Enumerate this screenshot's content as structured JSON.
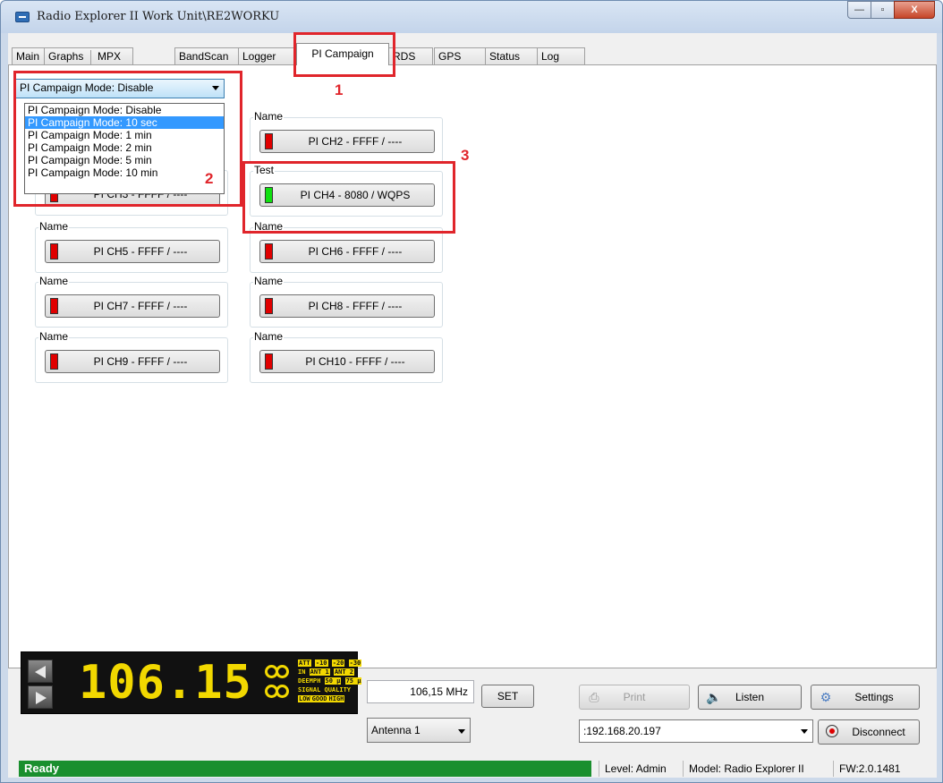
{
  "window": {
    "title": "Radio Explorer II Work Unit\\RE2WORKU",
    "controls": {
      "minimize": "—",
      "maximize": "▫",
      "close": "X"
    }
  },
  "tabs": [
    {
      "label": "Main"
    },
    {
      "label": "Graphs"
    },
    {
      "label": "MPX"
    },
    {
      "label": "BandScan"
    },
    {
      "label": "Logger"
    },
    {
      "label": "PI Campaign"
    },
    {
      "label": "RDS"
    },
    {
      "label": "GPS"
    },
    {
      "label": "Status"
    },
    {
      "label": "Log"
    }
  ],
  "active_tab": "PI Campaign",
  "campaign": {
    "mode_selected": "PI Campaign Mode: Disable",
    "mode_options": [
      "PI Campaign Mode: Disable",
      "PI Campaign Mode: 10 sec",
      "PI Campaign Mode: 1 min",
      "PI Campaign Mode: 2 min",
      "PI Campaign Mode: 5 min",
      "PI Campaign Mode: 10 min"
    ],
    "highlighted_option": "PI Campaign Mode: 10 sec",
    "channels": [
      {
        "group_name": "Name",
        "label": "PI CH2 - FFFF / ----",
        "status": "red"
      },
      {
        "group_name": "",
        "label": "PI CH3 - FFFF / ----",
        "status": "red"
      },
      {
        "group_name": "Test",
        "label": "PI CH4 - 8080 / WQPS",
        "status": "green"
      },
      {
        "group_name": "Name",
        "label": "PI CH5 - FFFF / ----",
        "status": "red"
      },
      {
        "group_name": "Name",
        "label": "PI CH6 - FFFF / ----",
        "status": "red"
      },
      {
        "group_name": "Name",
        "label": "PI CH7 - FFFF / ----",
        "status": "red"
      },
      {
        "group_name": "Name",
        "label": "PI CH8 - FFFF / ----",
        "status": "red"
      },
      {
        "group_name": "Name",
        "label": "PI CH9 - FFFF / ----",
        "status": "red"
      },
      {
        "group_name": "Name",
        "label": "PI CH10 - FFFF / ----",
        "status": "red"
      }
    ]
  },
  "annotations": [
    "1",
    "2",
    "3"
  ],
  "display": {
    "digits": "106.15",
    "indicators": {
      "att": [
        "ATT",
        "-10",
        "-20",
        "-30"
      ],
      "input": [
        "IN",
        "ANT 1",
        "ANT 2"
      ],
      "deemph": [
        "DEEMPH",
        "50 μ",
        "75 μ"
      ],
      "signal_quality": "SIGNAL QUALITY",
      "levels": [
        "LOW",
        "GOOD",
        "HIGH"
      ]
    }
  },
  "controls": {
    "frequency": "106,15 MHz",
    "set_label": "SET",
    "antenna": "Antenna 1",
    "print_label": "Print",
    "listen_label": "Listen",
    "settings_label": "Settings",
    "address": ":192.168.20.197",
    "disconnect_label": "Disconnect"
  },
  "status": {
    "state": "Ready",
    "level": "Level: Admin",
    "model": "Model: Radio Explorer II",
    "fw": "FW:2.0.1481"
  },
  "colors": {
    "led_red": "#e00000",
    "led_green": "#10e010",
    "display_digits": "#f2d800",
    "status_ready": "#1a8f2e",
    "annotation": "#e0252b",
    "highlight": "#3399ff"
  }
}
